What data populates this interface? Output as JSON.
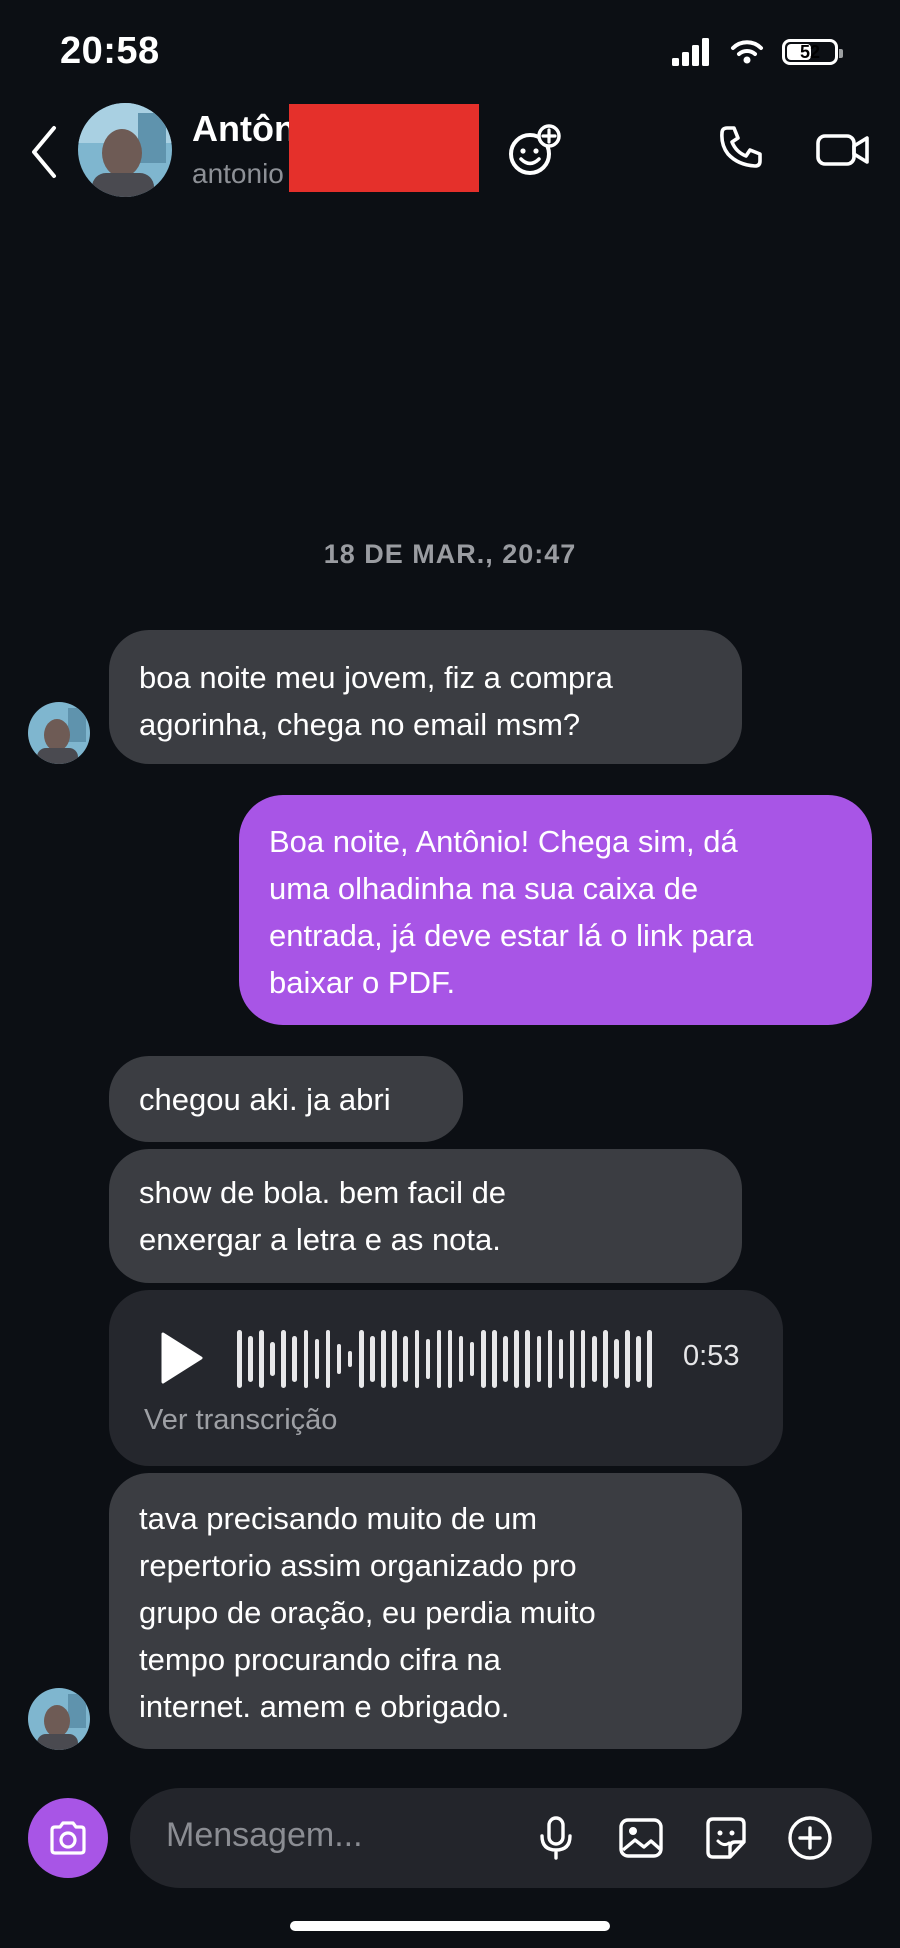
{
  "status_bar": {
    "time": "20:58",
    "battery": "52",
    "battery_level": 0.52
  },
  "header": {
    "name": "Antôn",
    "username": "antonio",
    "icons": [
      "back-chevron-icon",
      "avatar",
      "emoji-add-icon",
      "phone-icon",
      "video-camera-icon"
    ]
  },
  "conversation": {
    "date_separator": "18 DE MAR., 20:47",
    "messages": [
      {
        "direction": "in",
        "text": "boa noite meu jovem, fiz a compra\nagorinha, chega no email msm?"
      },
      {
        "direction": "out",
        "text": "Boa noite, Antônio! Chega sim, dá\numa olhadinha na sua caixa de\nentrada, já deve estar lá o link para\nbaixar o PDF."
      },
      {
        "direction": "in",
        "text": "chegou aki. ja abri"
      },
      {
        "direction": "in",
        "text": "show de bola. bem facil de\nenxergar a letra e as nota."
      },
      {
        "direction": "in",
        "type": "audio",
        "duration": "0:53",
        "transcription_link": "Ver transcrição"
      },
      {
        "direction": "in",
        "text": "tava precisando muito de um\nrepertorio assim organizado pro\ngrupo de oração, eu perdia muito\ntempo procurando cifra na\ninternet. amem e obrigado."
      }
    ]
  },
  "composer": {
    "placeholder": "Mensagem...",
    "icons": [
      "camera-icon",
      "microphone-icon",
      "gallery-icon",
      "sticker-icon",
      "plus-icon"
    ]
  },
  "colors": {
    "background": "#0c0f14",
    "incoming_bubble": "#3b3d42",
    "outgoing_bubble": "#a855e6",
    "audio_bubble": "#25272d",
    "redaction": "#e5302b"
  }
}
